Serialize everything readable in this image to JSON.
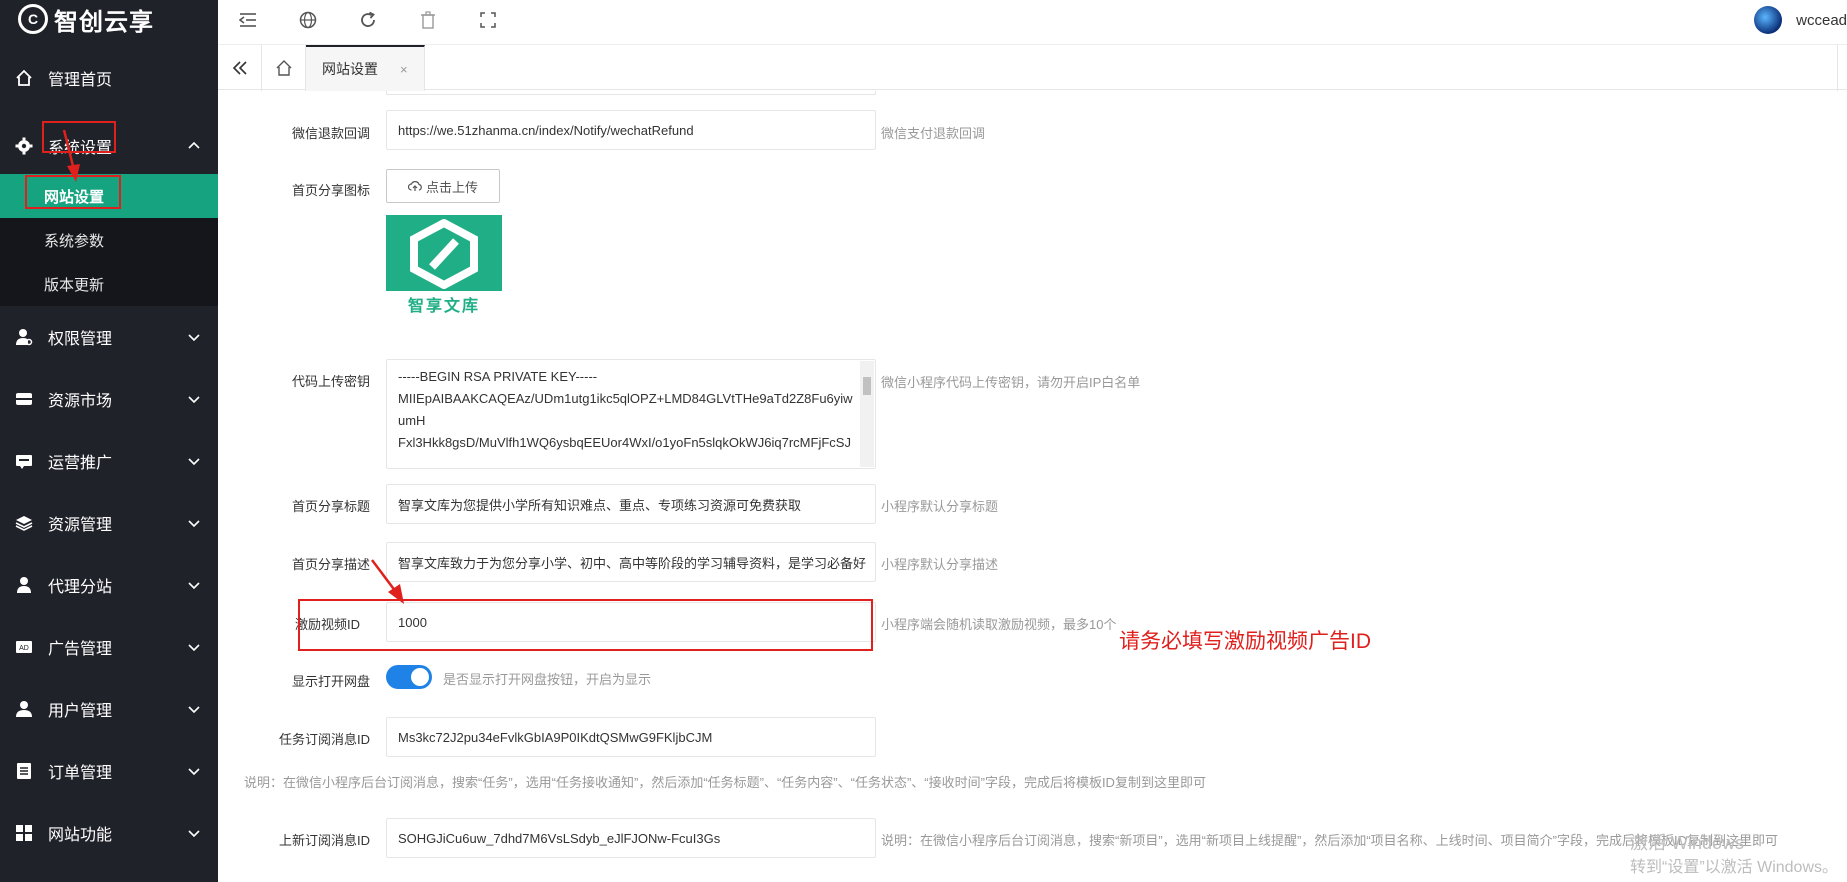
{
  "app": {
    "logo_text": "智创云享"
  },
  "sidebar": {
    "items": [
      {
        "label": "管理首页",
        "icon": "home-icon"
      },
      {
        "label": "系统设置",
        "icon": "gear-icon",
        "expanded": true,
        "children": [
          "网站设置",
          "系统参数",
          "版本更新"
        ],
        "active_child": "网站设置"
      },
      {
        "label": "权限管理",
        "icon": "user-key-icon"
      },
      {
        "label": "资源市场",
        "icon": "box-icon"
      },
      {
        "label": "运营推广",
        "icon": "megaphone-icon"
      },
      {
        "label": "资源管理",
        "icon": "layers-icon"
      },
      {
        "label": "代理分站",
        "icon": "group-icon"
      },
      {
        "label": "广告管理",
        "icon": "ad-icon"
      },
      {
        "label": "用户管理",
        "icon": "user-icon"
      },
      {
        "label": "订单管理",
        "icon": "list-icon"
      },
      {
        "label": "网站功能",
        "icon": "grid-icon"
      }
    ]
  },
  "topbar": {
    "icons": [
      "collapse-menu-icon",
      "globe-icon",
      "refresh-icon",
      "clear-cache-icon",
      "fullscreen-icon"
    ],
    "username": "wccead"
  },
  "tabs": [
    {
      "label": "网站设置",
      "close": "×"
    }
  ],
  "form": {
    "refund_callback": {
      "label": "微信退款回调",
      "value": "https://we.51zhanma.cn/index/Notify/wechatRefund",
      "hint": "微信支付退款回调"
    },
    "share_icon": {
      "label": "首页分享图标",
      "button": "点击上传",
      "image_caption": "智享文库"
    },
    "upload_key": {
      "label": "代码上传密钥",
      "value": "-----BEGIN RSA PRIVATE KEY-----\nMIIEpAIBAAKCAQEAz/UDm1utg1ikc5qlOPZ+LMD84GLVtTHe9aTd2Z8Fu6yiwumH\nFxl3Hkk8gsD/MuVlfh1WQ6ysbqEEUor4WxI/o1yoFn5slqkOkWJ6iq7rcMFjFcSJ",
      "hint": "微信小程序代码上传密钥，请勿开启IP白名单"
    },
    "share_title": {
      "label": "首页分享标题",
      "value": "智享文库为您提供小学所有知识难点、重点、专项练习资源可免费获取",
      "hint": "小程序默认分享标题"
    },
    "share_desc": {
      "label": "首页分享描述",
      "value": "智享文库致力于为您分享小学、初中、高中等阶段的学习辅导资料，是学习必备好",
      "hint": "小程序默认分享描述"
    },
    "reward_video": {
      "label": "激励视频ID",
      "value": "1000",
      "hint": "小程序端会随机读取激励视频，最多10个"
    },
    "show_netdisk": {
      "label": "显示打开网盘",
      "on": true,
      "hint": "是否显示打开网盘按钮，开启为显示"
    },
    "task_sub_id": {
      "label": "任务订阅消息ID",
      "value": "Ms3kc72J2pu34eFvlkGbIA9P0IKdtQSMwG9FKljbCJM"
    },
    "task_note": "说明：在微信小程序后台订阅消息，搜索“任务”，选用“任务接收通知”，然后添加“任务标题”、“任务内容”、“任务状态”、“接收时间”字段，完成后将模板ID复制到这里即可",
    "new_sub_id": {
      "label": "上新订阅消息ID",
      "value": "SOHGJiCu6uw_7dhd7M6VsLSdyb_eJlFJONw-FcuI3Gs",
      "hint": "说明：在微信小程序后台订阅消息，搜索“新项目”，选用“新项目上线提醒”，然后添加“项目名称、上线时间、项目简介”字段，完成后将模板ID复制到这里即可"
    }
  },
  "annotation": {
    "text": "请务必填写激励视频广告ID",
    "color": "#e0201d"
  },
  "watermark": {
    "line1": "激活 Windows",
    "line2": "转到“设置”以激活 Windows。"
  },
  "colors": {
    "sidebar_bg": "#20222a",
    "active": "#16a37f",
    "switch": "#1e82e6",
    "annotation": "#e0201d"
  }
}
